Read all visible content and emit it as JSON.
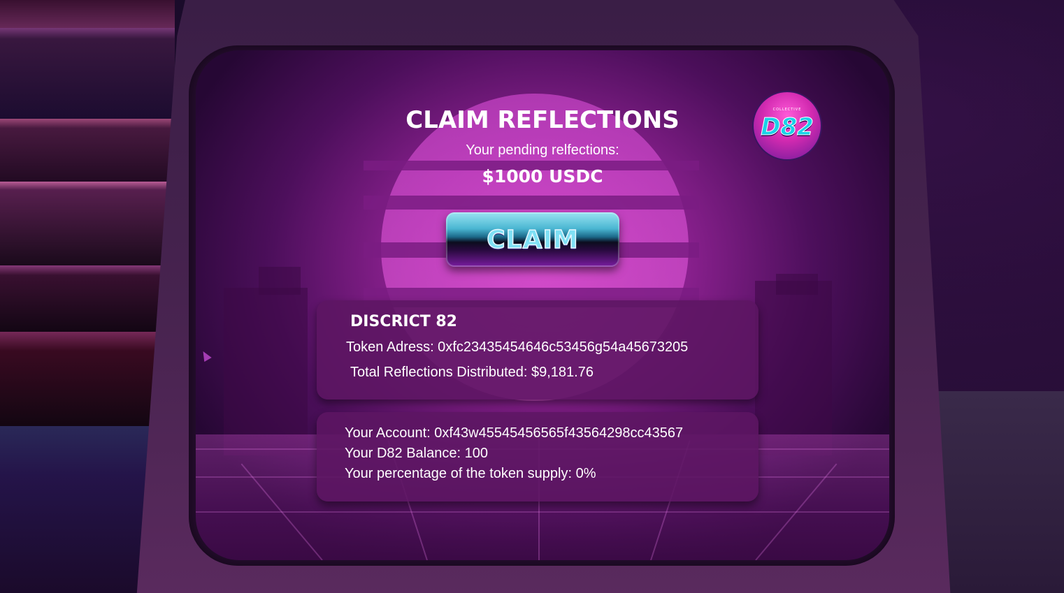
{
  "screen": {
    "title": "CLAIM REFLECTIONS",
    "pending_label": "Your pending relfections:",
    "pending_value": "$1000 USDC",
    "claim_button_label": "CLAIM"
  },
  "logo": {
    "small_text": "COLLECTIVE",
    "main_text": "D82"
  },
  "token_card": {
    "title": "DISCRICT 82",
    "token_address": "Token Adress: 0xfc23435454646c53456g54a45673205",
    "total_distributed": "Total Reflections Distributed: $9,181.76"
  },
  "account_card": {
    "account": "Your Account: 0xf43w45545456565f43564298cc43567",
    "balance": "Your D82 Balance: 100",
    "percentage": "Your percentage of the token supply: 0%"
  },
  "colors": {
    "accent_pink": "#c23ab6",
    "card_bg": "#5c1662",
    "claim_cyan": "#7fe0f5"
  }
}
